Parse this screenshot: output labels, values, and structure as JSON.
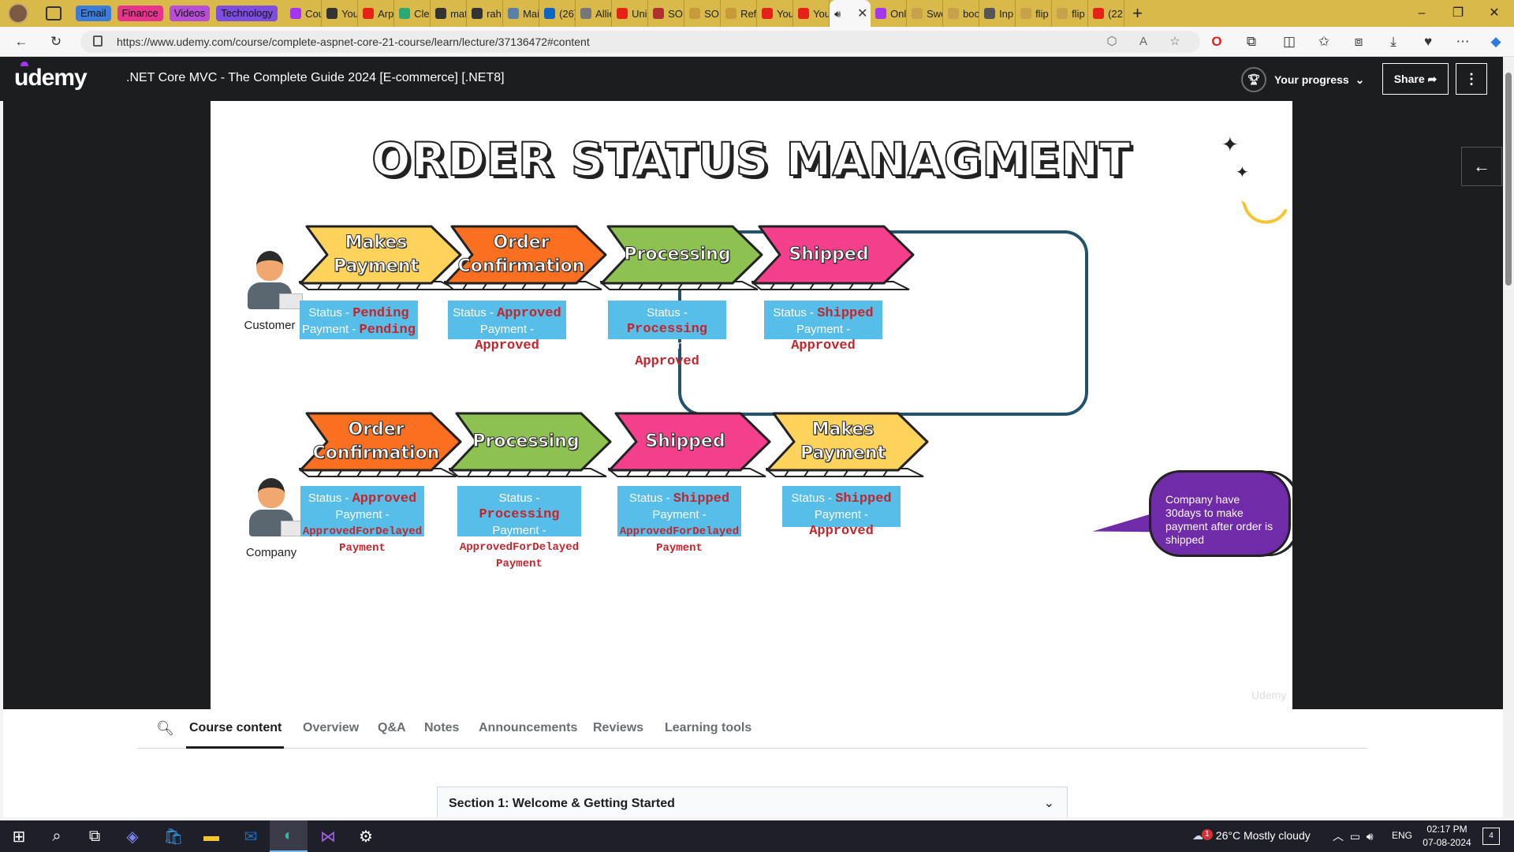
{
  "browser": {
    "tab_groups": [
      {
        "label": "Email",
        "color": "#3b7dd8"
      },
      {
        "label": "Finance",
        "color": "#e6358c"
      },
      {
        "label": "Videos",
        "color": "#b64fd6"
      },
      {
        "label": "Technology",
        "color": "#7c4dde"
      }
    ],
    "tabs": [
      {
        "label": "Cou",
        "icon": "udemy-icon",
        "color": "#a435f0"
      },
      {
        "label": "You",
        "icon": "github-icon",
        "color": "#333333"
      },
      {
        "label": "Arp",
        "icon": "youtube-icon",
        "color": "#e62117"
      },
      {
        "label": "Cle",
        "icon": "tab-favicon",
        "color": "#2aa876"
      },
      {
        "label": "mat",
        "icon": "github-icon",
        "color": "#333333"
      },
      {
        "label": "rah",
        "icon": "github-icon",
        "color": "#333333"
      },
      {
        "label": "Mai",
        "icon": "tab-favicon",
        "color": "#5b7fa6"
      },
      {
        "label": "(26)",
        "icon": "linkedin-icon",
        "color": "#0a66c2"
      },
      {
        "label": "Allie",
        "icon": "document-icon",
        "color": "#777777"
      },
      {
        "label": "Uni",
        "icon": "youtube-icon",
        "color": "#e62117"
      },
      {
        "label": "SOL",
        "icon": "tab-favicon",
        "color": "#b03030"
      },
      {
        "label": "SOL",
        "icon": "tab-favicon",
        "color": "#c79a3a"
      },
      {
        "label": "Refa",
        "icon": "tab-favicon",
        "color": "#c79a3a"
      },
      {
        "label": "You",
        "icon": "youtube-icon",
        "color": "#e62117"
      },
      {
        "label": "You",
        "icon": "youtube-icon",
        "color": "#e62117"
      },
      {
        "label": "",
        "icon": "speaker-icon",
        "color": "#f7f7f7",
        "active": true
      },
      {
        "label": "Onl",
        "icon": "udemy-icon",
        "color": "#a435f0"
      },
      {
        "label": "Swe",
        "icon": "tab-favicon",
        "color": "#c7a24b"
      },
      {
        "label": "boc",
        "icon": "tab-favicon",
        "color": "#c7a24b"
      },
      {
        "label": "Inp",
        "icon": "tab-favicon",
        "color": "#555555"
      },
      {
        "label": "flip",
        "icon": "tab-favicon",
        "color": "#c7a24b"
      },
      {
        "label": "flip",
        "icon": "tab-favicon",
        "color": "#c7a24b"
      },
      {
        "label": "(22",
        "icon": "youtube-icon",
        "color": "#e62117"
      }
    ],
    "url": "https://www.udemy.com/course/complete-aspnet-core-21-course/learn/lecture/37136472#content"
  },
  "udemy": {
    "logo": "udemy",
    "course_title": ".NET Core MVC - The Complete Guide 2024 [E-commerce] [.NET8]",
    "progress_label": "Your progress",
    "share_label": "Share"
  },
  "slide": {
    "title": "ORDER STATUS MANAGMENT",
    "watermark": "Udemy",
    "customer_row": {
      "actor": "Customer",
      "steps": [
        {
          "label": "Makes Payment",
          "color": "#fdd35c",
          "status_label": "Status - ",
          "status": "Pending",
          "payment_label": "Payment - ",
          "payment": "Pending"
        },
        {
          "label": "Order Confirmation",
          "color": "#fb7020",
          "status_label": "Status - ",
          "status": "Approved",
          "payment_label": "Payment - ",
          "payment": "Approved"
        },
        {
          "label": "Processing",
          "color": "#8dc152",
          "status_label": "Status - ",
          "status": "Processing",
          "payment_label": "Payment - ",
          "payment": "Approved"
        },
        {
          "label": "Shipped",
          "color": "#f43f8d",
          "status_label": "Status - ",
          "status": "Shipped",
          "payment_label": "Payment - ",
          "payment": "Approved"
        }
      ]
    },
    "company_row": {
      "actor": "Company",
      "steps": [
        {
          "label": "Order Confirmation",
          "color": "#fb7020",
          "status_label": "Status - ",
          "status": "Approved",
          "payment_label": "Payment - ",
          "payment": "ApprovedForDelayed Payment"
        },
        {
          "label": "Processing",
          "color": "#8dc152",
          "status_label": "Status - ",
          "status": "Processing",
          "payment_label": "Payment - ",
          "payment": "ApprovedForDelayed Payment"
        },
        {
          "label": "Shipped",
          "color": "#f43f8d",
          "status_label": "Status - ",
          "status": "Shipped",
          "payment_label": "Payment - ",
          "payment": "ApprovedForDelayed Payment"
        },
        {
          "label": "Makes Payment",
          "color": "#fdd35c",
          "status_label": "Status - ",
          "status": "Shipped",
          "payment_label": "Payment - ",
          "payment": "Approved"
        }
      ],
      "note": "Company have 30days to make payment after order is shipped"
    }
  },
  "content_tabs": [
    "Course content",
    "Overview",
    "Q&A",
    "Notes",
    "Announcements",
    "Reviews",
    "Learning tools"
  ],
  "section": {
    "title": "Section 1: Welcome & Getting Started"
  },
  "taskbar": {
    "weather": "26°C  Mostly cloudy",
    "weather_badge": "1",
    "lang": "ENG",
    "time": "02:17 PM",
    "date": "07-08-2024",
    "notif_count": "4"
  }
}
